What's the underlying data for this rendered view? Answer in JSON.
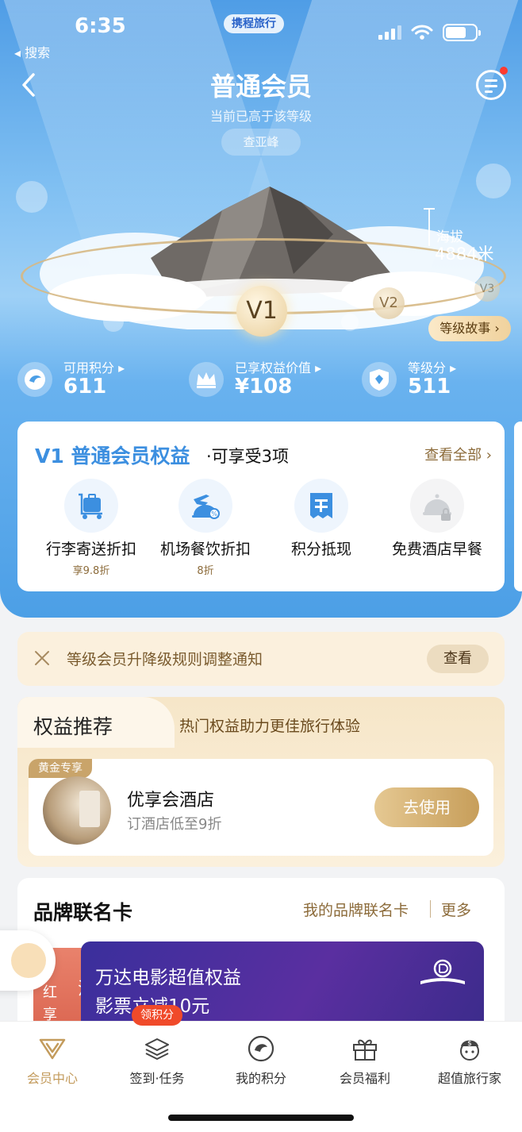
{
  "status": {
    "time": "6:35",
    "brand": "携程旅行"
  },
  "nav": {
    "back_label": "◂ 搜索",
    "title": "普通会员",
    "subtitle": "当前已高于该等级",
    "peak_button": "查亚峰"
  },
  "hero": {
    "altitude_label": "海拔",
    "altitude_value": "4884米",
    "levels": [
      "V1",
      "V2",
      "V3"
    ],
    "story_button": "等级故事 ›"
  },
  "stats": [
    {
      "label": "可用积分 ▸",
      "value": "611",
      "icon": "dolphin-coin-icon"
    },
    {
      "label": "已享权益价值 ▸",
      "value": "¥108",
      "icon": "crown-icon"
    },
    {
      "label": "等级分 ▸",
      "value": "511",
      "icon": "level-shield-icon"
    }
  ],
  "benefits": {
    "head": "V1 普通会员权益",
    "sub": "·可享受3项",
    "view_all": "查看全部 ›",
    "items": [
      {
        "name": "行李寄送折扣",
        "note": "享9.8折",
        "icon": "luggage-cart-icon",
        "locked": false
      },
      {
        "name": "机场餐饮折扣",
        "note": "8折",
        "icon": "plane-dining-icon",
        "locked": false
      },
      {
        "name": "积分抵现",
        "note": "",
        "icon": "points-offset-icon",
        "locked": false
      },
      {
        "name": "免费酒店早餐",
        "note": "",
        "icon": "hotel-breakfast-icon",
        "locked": true
      }
    ]
  },
  "notice": {
    "text": "等级会员升降级规则调整通知",
    "button": "查看"
  },
  "recommend": {
    "title": "权益推荐",
    "subtitle": "热门权益助力更佳旅行体验",
    "badge": "黄金专享",
    "name": "优享会酒店",
    "desc": "订酒店低至9折",
    "button": "去使用"
  },
  "brand": {
    "title": "品牌联名卡",
    "mine": "我的品牌联名卡",
    "more": "更多",
    "back_text": [
      "汉",
      "红",
      "享"
    ],
    "card_line1": "万达电影超值权益",
    "card_line2": "影票立减10元"
  },
  "tabbar": {
    "badge": "领积分",
    "tabs": [
      {
        "label": "会员中心",
        "icon": "vip-v-icon",
        "active": true
      },
      {
        "label": "签到·任务",
        "icon": "layers-icon",
        "active": false
      },
      {
        "label": "我的积分",
        "icon": "points-coin-icon",
        "active": false
      },
      {
        "label": "会员福利",
        "icon": "gift-icon",
        "active": false
      },
      {
        "label": "超值旅行家",
        "icon": "traveler-icon",
        "active": false
      }
    ]
  },
  "colors": {
    "accent_blue": "#3c8fe0",
    "gold": "#c39b5c",
    "badge_red": "#f04a2a"
  }
}
